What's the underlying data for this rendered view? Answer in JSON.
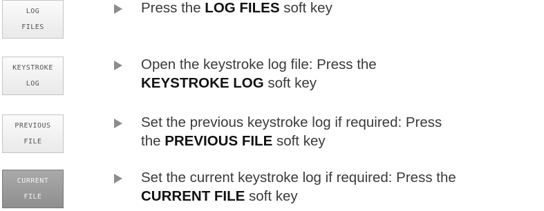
{
  "steps": [
    {
      "softkey": {
        "line1": "LOG",
        "line2": "FILES"
      },
      "text": {
        "before": "Press the ",
        "bold": "LOG FILES",
        "after": " soft key"
      }
    },
    {
      "softkey": {
        "line1": "KEYSTROKE",
        "line2": "LOG"
      },
      "text": {
        "before": "Open the keystroke log file: Press the",
        "bold": "KEYSTROKE LOG",
        "after": " soft key"
      }
    },
    {
      "softkey": {
        "line1": "PREVIOUS",
        "line2": "FILE"
      },
      "text": {
        "before": "Set the previous keystroke log if required: Press",
        "before2": "the ",
        "bold": "PREVIOUS FILE",
        "after": " soft key"
      }
    },
    {
      "softkey": {
        "line1": "CURRENT",
        "line2": "FILE"
      },
      "text": {
        "before": "Set the current keystroke log if required: Press the",
        "bold": "CURRENT FILE",
        "after": " soft key"
      }
    }
  ],
  "colors": {
    "bullet": "#8c8c8c",
    "text": "#3a3a3a",
    "softkey_highlight": "#9b9b9b"
  },
  "icons": {
    "bullet": "triangle-right-icon"
  }
}
